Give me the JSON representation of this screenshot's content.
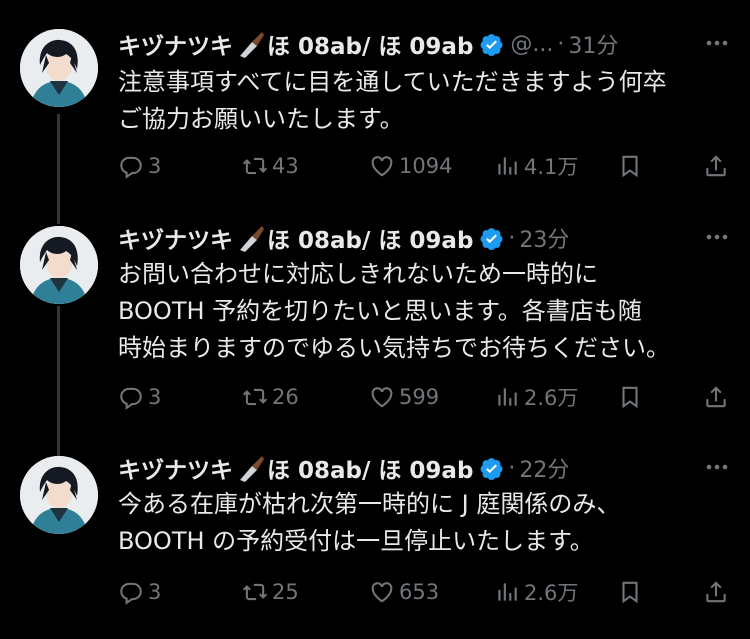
{
  "thread": {
    "tweets": [
      {
        "display_name": "キヅナツキ",
        "name_suffix": "ほ 08ab/ ほ 09ab",
        "handle": "@...",
        "separator": "·",
        "time": "31分",
        "text": "注意事項すべてに目を通していただきますよう何卒\nご協力お願いいたします。",
        "replies": "3",
        "reposts": "43",
        "likes": "1094",
        "views": "4.1万"
      },
      {
        "display_name": "キヅナツキ",
        "name_suffix": "ほ 08ab/ ほ 09ab",
        "handle": "",
        "separator": "·",
        "time": "23分",
        "text": "お問い合わせに対応しきれないため一時的に\nBOOTH 予約を切りたいと思います。各書店も随\n時始まりますのでゆるい気持ちでお待ちください。",
        "replies": "3",
        "reposts": "26",
        "likes": "599",
        "views": "2.6万"
      },
      {
        "display_name": "キヅナツキ",
        "name_suffix": "ほ 08ab/ ほ 09ab",
        "handle": "",
        "separator": "·",
        "time": "22分",
        "text": "今ある在庫が枯れ次第一時的に J 庭関係のみ、\nBOOTH の予約受付は一旦停止いたします。",
        "replies": "3",
        "reposts": "25",
        "likes": "653",
        "views": "2.6万"
      }
    ]
  },
  "icons": [
    "avatar",
    "knife-emoji-icon",
    "verified-badge-icon",
    "more-icon",
    "reply-icon",
    "repost-icon",
    "like-icon",
    "views-icon",
    "bookmark-icon",
    "share-icon"
  ],
  "colors": {
    "background": "#000000",
    "text": "#e7e9ea",
    "secondary": "#71767b",
    "verified": "#1d9bf0",
    "thread_line": "#333639"
  }
}
